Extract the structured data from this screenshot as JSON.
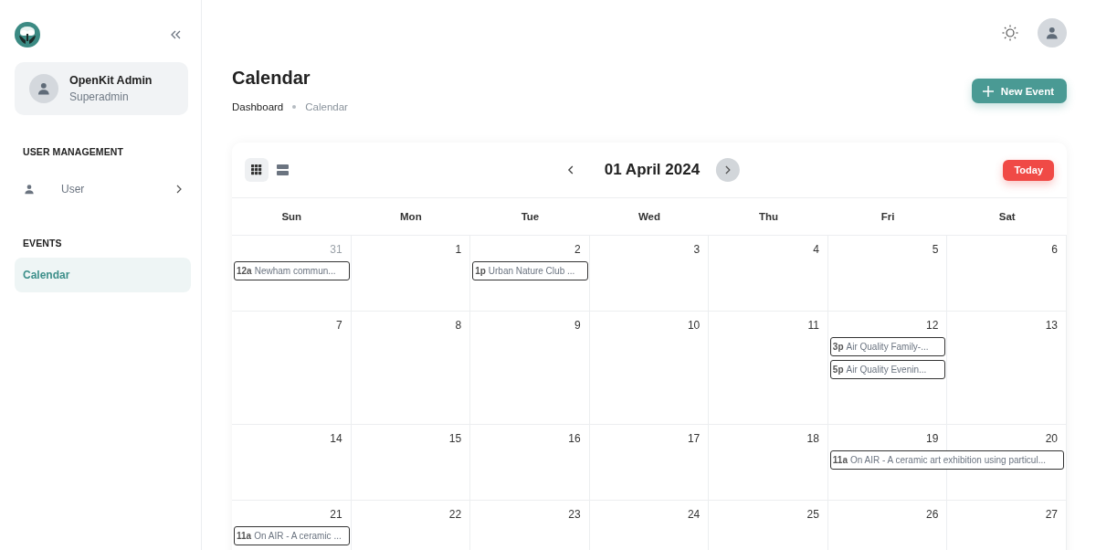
{
  "sidebar": {
    "user": {
      "name": "OpenKit Admin",
      "role": "Superadmin"
    },
    "sections": [
      {
        "heading": "USER MANAGEMENT",
        "items": [
          {
            "label": "User",
            "selected": false,
            "expandable": true
          }
        ]
      },
      {
        "heading": "EVENTS",
        "items": [
          {
            "label": "Calendar",
            "selected": true,
            "expandable": false
          }
        ]
      }
    ]
  },
  "page": {
    "title": "Calendar",
    "breadcrumbs": [
      {
        "label": "Dashboard",
        "current": false
      },
      {
        "label": "Calendar",
        "current": true
      }
    ],
    "new_event_button": "New Event"
  },
  "calendar": {
    "view_buttons": [
      {
        "kind": "month",
        "selected": true
      },
      {
        "kind": "list",
        "selected": false
      }
    ],
    "title": "01 April 2024",
    "today_button": "Today",
    "weekdays": [
      "Sun",
      "Mon",
      "Tue",
      "Wed",
      "Thu",
      "Fri",
      "Sat"
    ],
    "weeks": [
      {
        "days": [
          {
            "number": "31",
            "outside_month": true,
            "events": [
              {
                "time": "12a",
                "title": "Newham commun...",
                "continues": false
              }
            ]
          },
          {
            "number": "1",
            "outside_month": false
          },
          {
            "number": "2",
            "outside_month": false,
            "events": [
              {
                "time": "1p",
                "title": "Urban Nature Club ...",
                "continues": false
              }
            ]
          },
          {
            "number": "3",
            "outside_month": false
          },
          {
            "number": "4",
            "outside_month": false
          },
          {
            "number": "5",
            "outside_month": false
          },
          {
            "number": "6",
            "outside_month": false
          }
        ]
      },
      {
        "days": [
          {
            "number": "7",
            "outside_month": false
          },
          {
            "number": "8",
            "outside_month": false
          },
          {
            "number": "9",
            "outside_month": false
          },
          {
            "number": "10",
            "outside_month": false
          },
          {
            "number": "11",
            "outside_month": false
          },
          {
            "number": "12",
            "outside_month": false,
            "events": [
              {
                "time": "3p",
                "title": "Air Quality Family-...",
                "continues": false
              },
              {
                "time": "5p",
                "title": "Air Quality Evenin...",
                "continues": false
              }
            ]
          },
          {
            "number": "13",
            "outside_month": false
          }
        ]
      },
      {
        "days": [
          {
            "number": "14",
            "outside_month": false
          },
          {
            "number": "15",
            "outside_month": false
          },
          {
            "number": "16",
            "outside_month": false
          },
          {
            "number": "17",
            "outside_month": false
          },
          {
            "number": "18",
            "outside_month": false
          },
          {
            "number": "19",
            "outside_month": false,
            "events": [
              {
                "time": "11a",
                "title": "On AIR - A ceramic art exhibition using particul...",
                "continues": true
              }
            ]
          },
          {
            "number": "20",
            "outside_month": false
          }
        ]
      },
      {
        "days": [
          {
            "number": "21",
            "outside_month": false,
            "events": [
              {
                "time": "11a",
                "title": "On AIR - A ceramic ...",
                "continues": false
              }
            ]
          },
          {
            "number": "22",
            "outside_month": false
          },
          {
            "number": "23",
            "outside_month": false
          },
          {
            "number": "24",
            "outside_month": false
          },
          {
            "number": "25",
            "outside_month": false
          },
          {
            "number": "26",
            "outside_month": false
          },
          {
            "number": "27",
            "outside_month": false
          }
        ]
      }
    ]
  }
}
